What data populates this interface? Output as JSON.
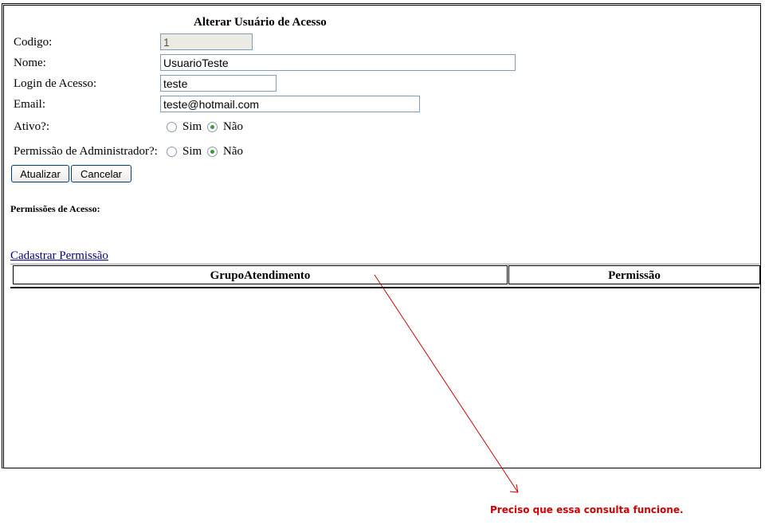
{
  "form": {
    "title": "Alterar Usuário de Acesso",
    "codigo_label": "Codigo:",
    "codigo_value": "1",
    "nome_label": "Nome:",
    "nome_value": "UsuarioTeste",
    "login_label": "Login de Acesso:",
    "login_value": "teste",
    "email_label": "Email:",
    "email_value": "teste@hotmail.com",
    "ativo_label": "Ativo?:",
    "admin_label": "Permissão de Administrador?:",
    "sim": "Sim",
    "nao": "Não",
    "atualizar": "Atualizar",
    "cancelar": "Cancelar"
  },
  "permissions": {
    "heading": "Permissões de Acesso:",
    "link": "Cadastrar Permissão",
    "columns": [
      "GrupoAtendimento",
      "Permissão"
    ]
  },
  "annotation": {
    "text": "Preciso que essa consulta funcione.",
    "color": "#cc0000"
  }
}
